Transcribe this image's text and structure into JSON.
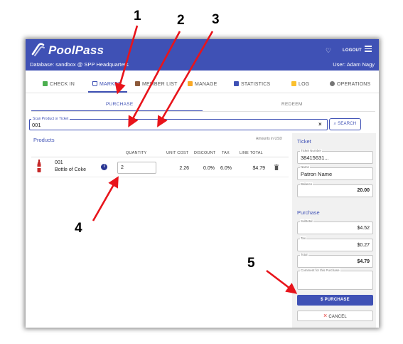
{
  "app": {
    "title": "PoolPass",
    "database": "Database: sandbox @ SPP Headquarters",
    "user": "User: Adam Nagy",
    "logout_label": "LOGOUT",
    "brand_color": "#3f51b5"
  },
  "nav": {
    "tabs": [
      {
        "label": "CHECK IN",
        "icon": "check-icon",
        "active": false
      },
      {
        "label": "MARKET",
        "icon": "cart-icon",
        "active": true
      },
      {
        "label": "MEMBER LIST",
        "icon": "member-list-icon",
        "active": false
      },
      {
        "label": "MANAGE",
        "icon": "manage-icon",
        "active": false
      },
      {
        "label": "STATISTICS",
        "icon": "statistics-icon",
        "active": false
      },
      {
        "label": "LOG",
        "icon": "folder-icon",
        "active": false
      },
      {
        "label": "OPERATIONS",
        "icon": "gear-icon",
        "active": false
      }
    ]
  },
  "subtabs": [
    {
      "label": "PURCHASE",
      "active": true
    },
    {
      "label": "REDEEM",
      "active": false
    }
  ],
  "scan": {
    "label": "Scan Product or Ticket",
    "value": "001",
    "search_label": "SEARCH"
  },
  "products": {
    "title": "Products",
    "currency_note": "Amounts in USD",
    "columns": [
      "QUANTITY",
      "UNIT COST",
      "DISCOUNT",
      "TAX",
      "LINE TOTAL"
    ],
    "rows": [
      {
        "code": "001",
        "name": "Bottle of Coke",
        "quantity": "2",
        "unit_cost": "2.26",
        "discount": "0.0%",
        "tax": "6.0%",
        "line_total": "$4.79"
      }
    ]
  },
  "ticket": {
    "title": "Ticket",
    "number_label": "Ticket Number",
    "number_value": "38415631...",
    "name_label": "Name",
    "name_value": "Patron Name",
    "balance_label": "Balance",
    "balance_value": "20.00"
  },
  "purchase": {
    "title": "Purchase",
    "subtotal_label": "Subtotal",
    "subtotal_value": "$4.52",
    "tax_label": "Tax",
    "tax_value": "$0.27",
    "total_label": "Total",
    "total_value": "$4.79",
    "comment_label": "Comment for this Purchase",
    "purchase_button": "PURCHASE",
    "cancel_button": "CANCEL"
  },
  "callouts": [
    "1",
    "2",
    "3",
    "4",
    "5"
  ],
  "callout_color": "#e8141b"
}
